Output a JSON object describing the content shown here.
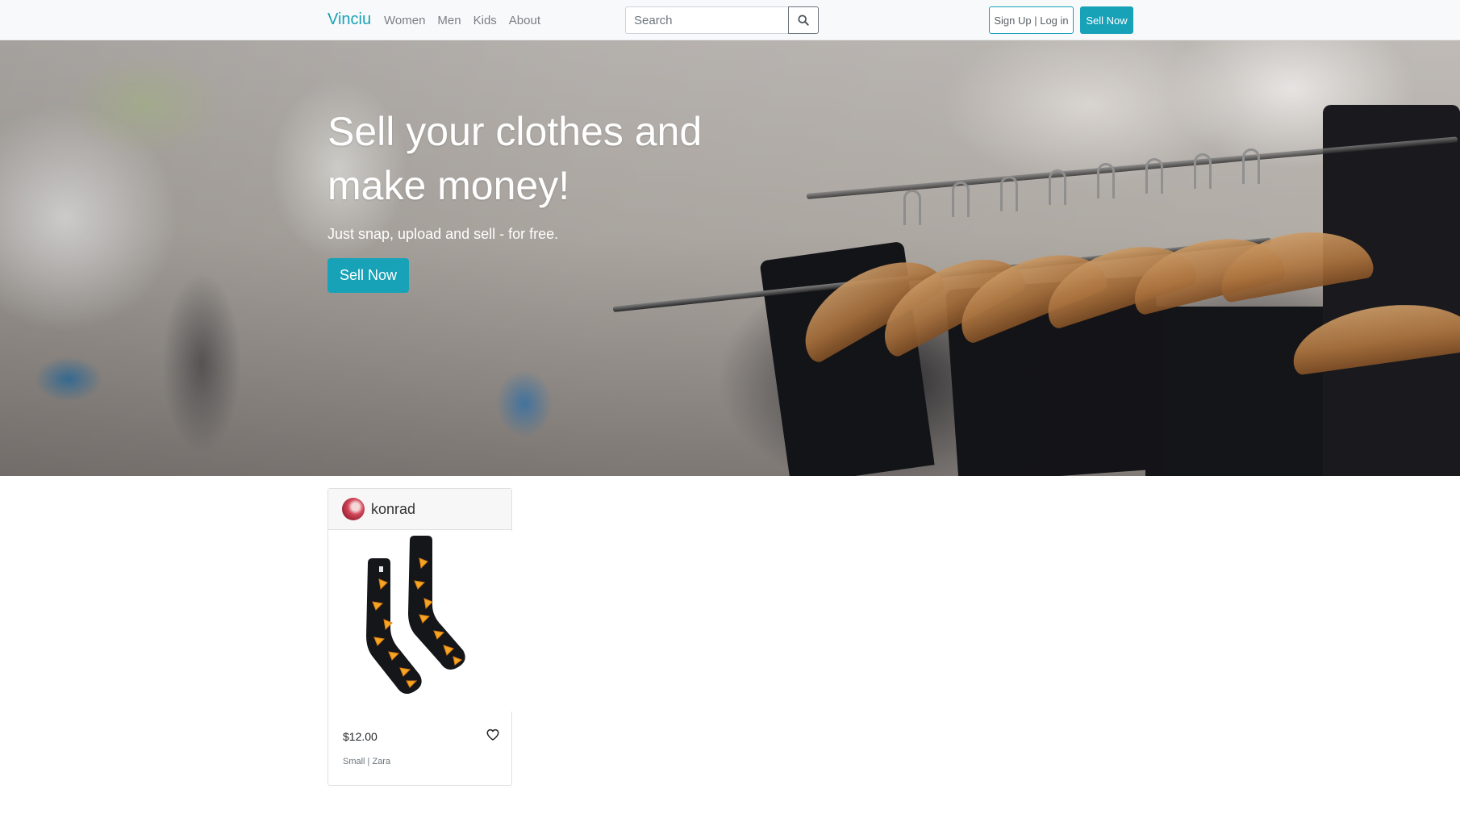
{
  "navbar": {
    "brand": "Vinciu",
    "links": [
      "Women",
      "Men",
      "Kids",
      "About"
    ],
    "search_placeholder": "Search",
    "search_icon": "search-icon",
    "signup_label": "Sign Up | Log in",
    "sell_label": "Sell Now"
  },
  "hero": {
    "title": "Sell your clothes and make money!",
    "subtitle": "Just snap, upload and sell - for free.",
    "button_label": "Sell Now"
  },
  "listing": {
    "seller": "konrad",
    "price": "$12.00",
    "meta": "Small | Zara",
    "favorite_icon": "heart-icon"
  },
  "colors": {
    "accent": "#17a2b8",
    "navbar_bg": "#f8f9fa"
  }
}
